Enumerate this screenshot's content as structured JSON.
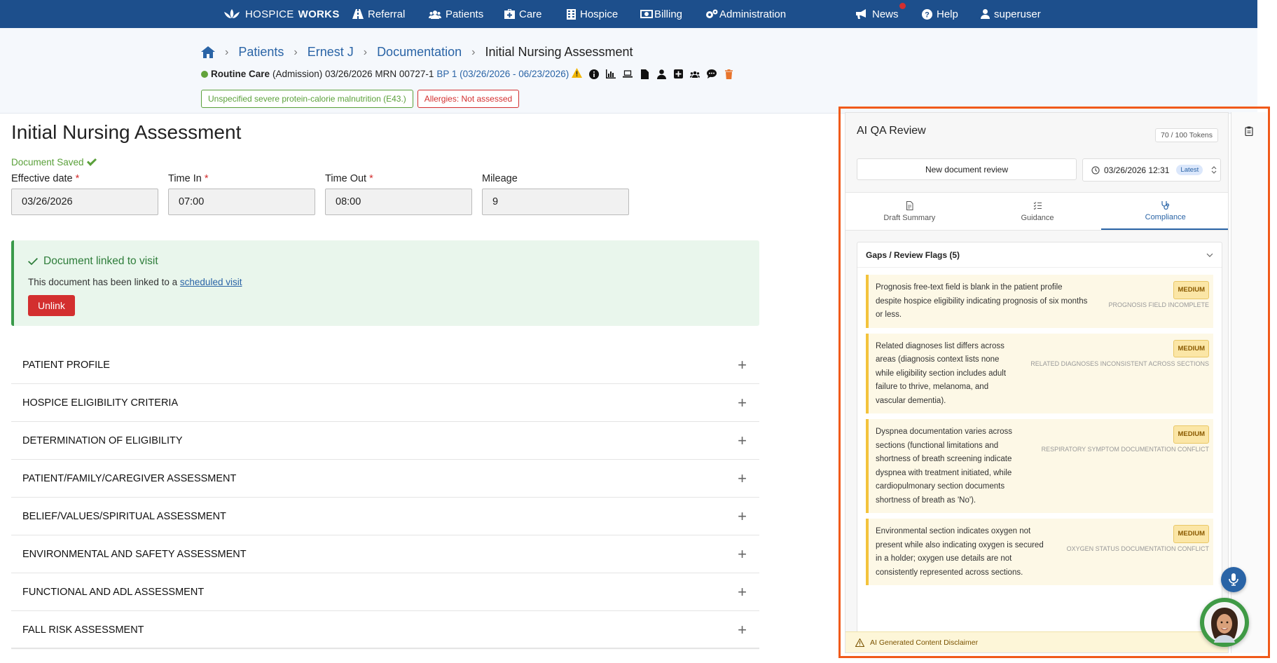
{
  "topnav": {
    "logo_a": "HOSPICE",
    "logo_b": "WORKS",
    "items": [
      "Referral",
      "Patients",
      "Care",
      "Hospice",
      "Billing",
      "Administration"
    ],
    "news": "News",
    "help": "Help",
    "user": "superuser"
  },
  "breadcrumb": {
    "patients": "Patients",
    "patient": "Ernest J",
    "documentation": "Documentation",
    "current": "Initial Nursing Assessment"
  },
  "patient_info": {
    "care_level": "Routine Care",
    "admission": "(Admission) 03/26/2026 MRN 00727-1",
    "benefit_period": "BP 1 (03/26/2026 - 06/23/2026)"
  },
  "tags": {
    "diagnosis": "Unspecified severe protein-calorie malnutrition (E43.)",
    "allergies": "Allergies: Not assessed"
  },
  "form": {
    "title": "Initial Nursing Assessment",
    "saved": "Document Saved",
    "effective_date_label": "Effective date",
    "effective_date": "03/26/2026",
    "time_in_label": "Time In",
    "time_in": "07:00",
    "time_out_label": "Time Out",
    "time_out": "08:00",
    "mileage_label": "Mileage",
    "mileage": "9"
  },
  "linked": {
    "title": "Document linked to visit",
    "desc": "This document has been linked to a",
    "link": "scheduled visit",
    "unlink": "Unlink"
  },
  "sections": [
    "PATIENT PROFILE",
    "HOSPICE ELIGIBILITY CRITERIA",
    "DETERMINATION OF ELIGIBILITY",
    "PATIENT/FAMILY/CAREGIVER ASSESSMENT",
    "BELIEF/VALUES/SPIRITUAL ASSESSMENT",
    "ENVIRONMENTAL AND SAFETY ASSESSMENT",
    "FUNCTIONAL AND ADL ASSESSMENT",
    "FALL RISK ASSESSMENT"
  ],
  "ai": {
    "title": "AI QA Review",
    "tokens": "70 / 100 Tokens",
    "new_review": "New document review",
    "review_date": "03/26/2026 12:31",
    "latest": "Latest",
    "tabs": [
      "Draft Summary",
      "Guidance",
      "Compliance"
    ],
    "gaps_title": "Gaps / Review Flags (5)",
    "flags": [
      {
        "severity": "MEDIUM",
        "category": "PROGNOSIS FIELD INCOMPLETE",
        "text": "Prognosis free-text field is blank in the patient profile despite hospice eligibility indicating prognosis of six months or less."
      },
      {
        "severity": "MEDIUM",
        "category": "RELATED DIAGNOSES INCONSISTENT ACROSS SECTIONS",
        "text": "Related diagnoses list differs across areas (diagnosis context lists none while eligibility section includes adult failure to thrive, melanoma, and vascular dementia)."
      },
      {
        "severity": "MEDIUM",
        "category": "RESPIRATORY SYMPTOM DOCUMENTATION CONFLICT",
        "text": "Dyspnea documentation varies across sections (functional limitations and shortness of breath screening indicate dyspnea with treatment initiated, while cardiopulmonary section documents shortness of breath as 'No')."
      },
      {
        "severity": "MEDIUM",
        "category": "OXYGEN STATUS DOCUMENTATION CONFLICT",
        "text": "Environmental section indicates oxygen not present while also indicating oxygen is secured in a holder; oxygen use details are not consistently represented across sections."
      }
    ],
    "disclaimer": "AI Generated Content Disclaimer"
  }
}
